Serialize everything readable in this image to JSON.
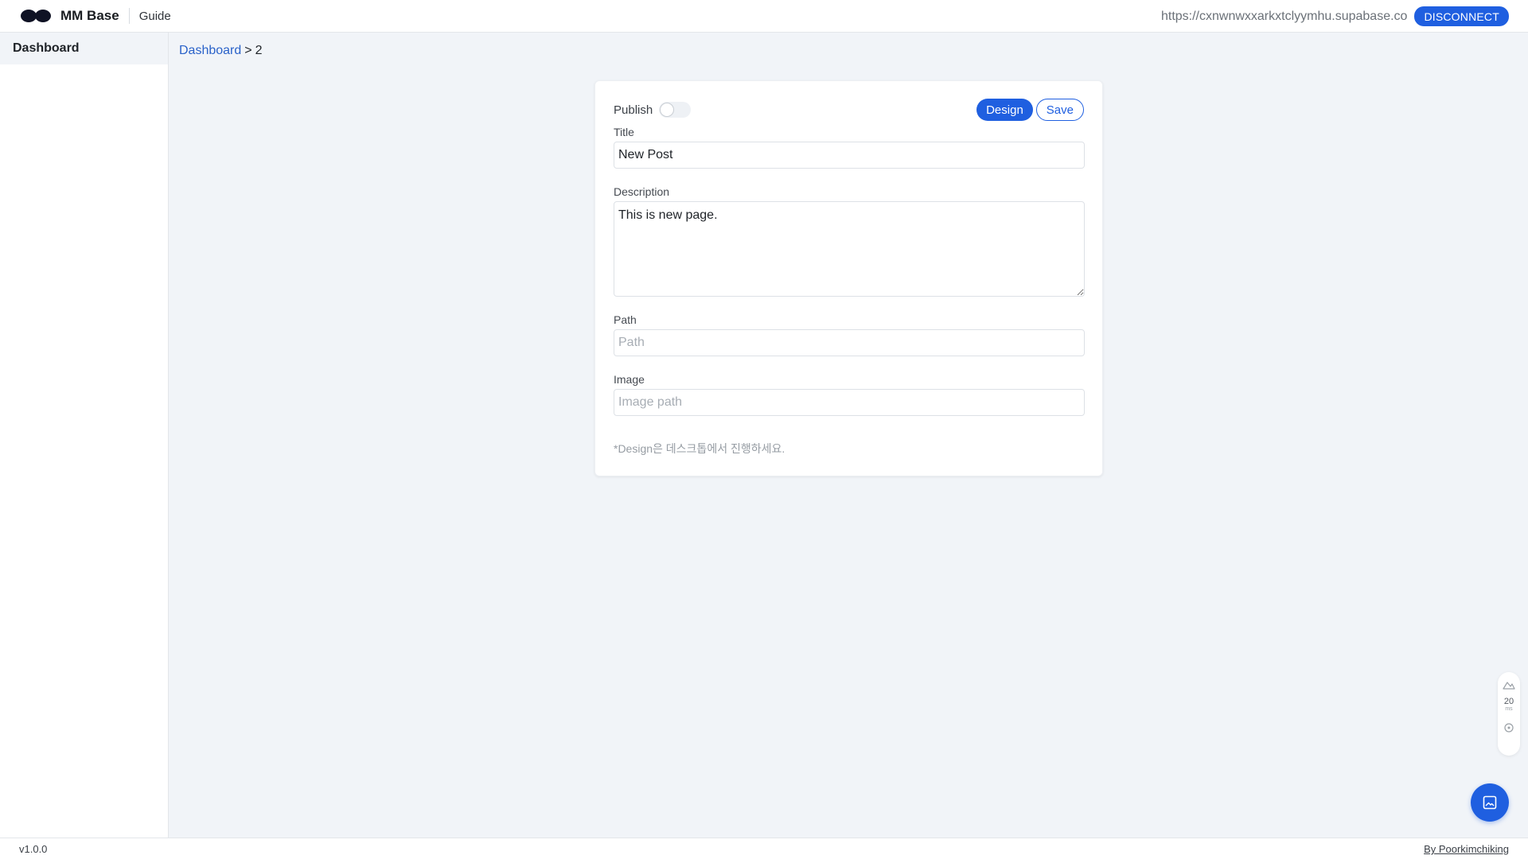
{
  "header": {
    "brand": "MM Base",
    "guide_label": "Guide",
    "connection_url": "https://cxnwnwxxarkxtclyymhu.supabase.co",
    "disconnect_label": "DISCONNECT"
  },
  "sidebar": {
    "items": [
      {
        "label": "Dashboard",
        "active": true
      }
    ]
  },
  "breadcrumb": {
    "root": "Dashboard",
    "separator": ">",
    "current": "2"
  },
  "editor": {
    "publish_label": "Publish",
    "publish_enabled": false,
    "design_label": "Design",
    "save_label": "Save",
    "title_label": "Title",
    "title_value": "New Post",
    "description_label": "Description",
    "description_value": "This is new page.",
    "path_label": "Path",
    "path_value": "",
    "path_placeholder": "Path",
    "image_label": "Image",
    "image_value": "",
    "image_placeholder": "Image path",
    "hint": "*Design은 데스크톱에서 진행하세요."
  },
  "widget": {
    "value": "20",
    "unit": "ms"
  },
  "footer": {
    "version": "v1.0.0",
    "credit": "By Poorkimchiking"
  },
  "colors": {
    "accent": "#1f5fe0",
    "background": "#f1f4f8",
    "link": "#2a62c9"
  },
  "icons": {
    "logo": "infinity-logo-icon",
    "widget_top": "chart-icon",
    "widget_bottom": "target-icon",
    "fab": "image-icon"
  }
}
